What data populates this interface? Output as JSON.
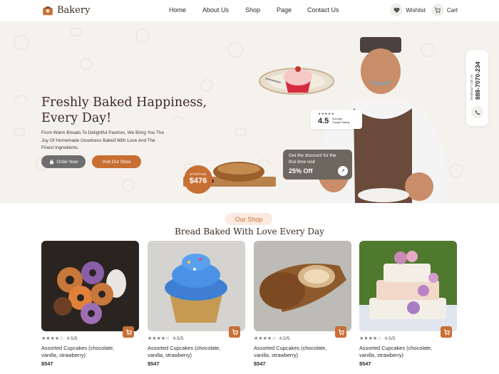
{
  "nav": {
    "brand": "Bakery",
    "links": [
      "Home",
      "About Us",
      "Shop",
      "Page",
      "Contact Us"
    ],
    "wishlist": "Wishlist",
    "cart": "Cart"
  },
  "hero": {
    "title_line1": "Freshly Baked Happiness,",
    "title_line2": "Every Day!",
    "subtitle_line1": "From Warm Breads To Delightful Pastries, We Bring You The",
    "subtitle_line2": "Joy Of Homemade Goodness Baked With Love And The",
    "subtitle_line3": "Finest Ingredients.",
    "order_button": "Order Now",
    "store_button": "Visit Our Store",
    "price_label": "STARTING",
    "price_value": "$476",
    "rating": {
      "stars": "★★★★★",
      "value": "4.5",
      "label_line1": "Average",
      "label_line2": "Google Rating"
    },
    "discount": {
      "line1": "Get the discount for the",
      "line2": "first time visit",
      "offer": "25% Off"
    },
    "call": {
      "label": "Booking? Call Us",
      "number": "888-7070-234"
    }
  },
  "shop": {
    "pill": "Our Shop",
    "title": "Bread Baked With Love Every Day",
    "products": [
      {
        "rating": "4.5/5",
        "name_line1": "Assorted Cupcakes (chocolate,",
        "name_line2": "vanilla, strawberry)",
        "price": "$547"
      },
      {
        "rating": "4.5/5",
        "name_line1": "Assorted Cupcakes (chocolate,",
        "name_line2": "vanilla, strawberry)",
        "price": "$547"
      },
      {
        "rating": "4.5/5",
        "name_line1": "Assorted Cupcakes (chocolate,",
        "name_line2": "vanilla, strawberry)",
        "price": "$547"
      },
      {
        "rating": "4.5/5",
        "name_line1": "Assorted Cupcakes (chocolate,",
        "name_line2": "vanilla, strawberry)",
        "price": "$547"
      }
    ]
  },
  "colors": {
    "accent": "#c86f34",
    "dark": "#3a2a1f",
    "hero_bg": "#f5f2ee"
  },
  "icons": [
    "bakery-logo-icon",
    "heart-icon",
    "cart-icon",
    "bag-icon",
    "arrow-up-right-icon",
    "phone-icon",
    "star-icon"
  ]
}
